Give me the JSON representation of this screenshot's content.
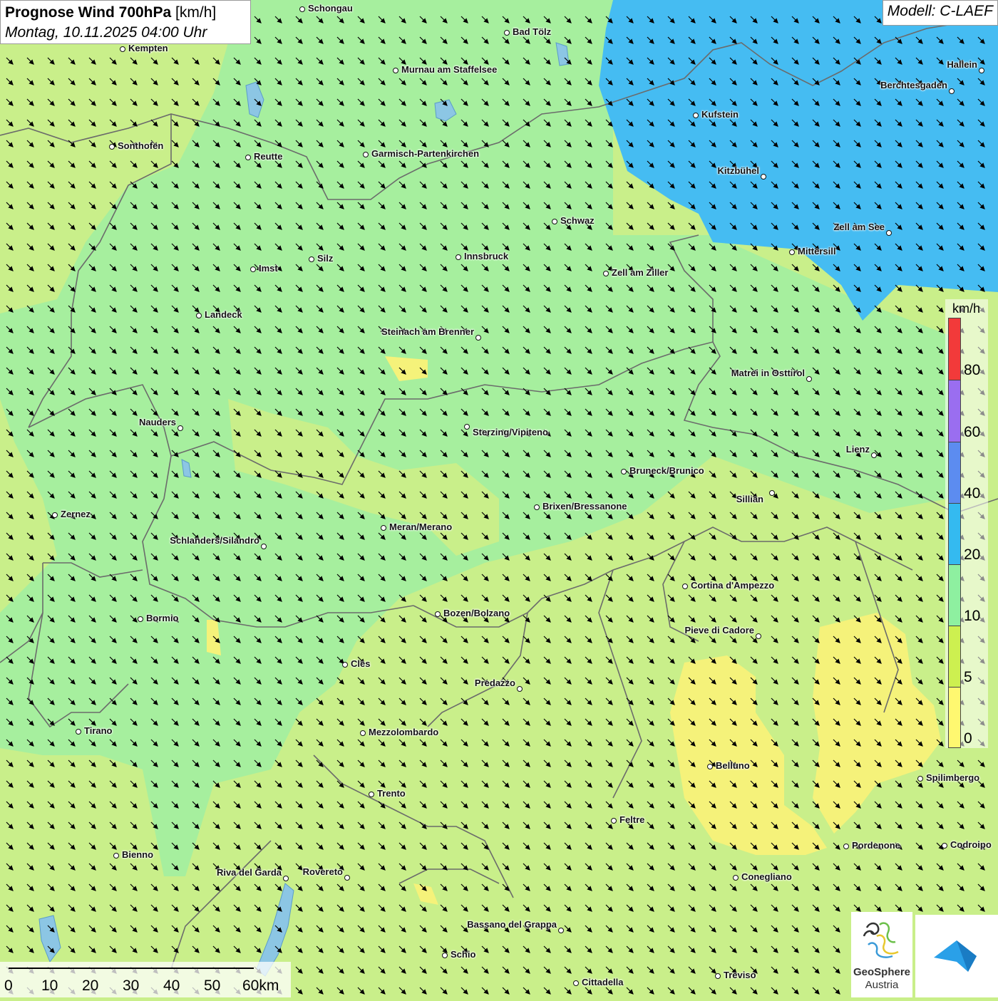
{
  "title": {
    "main": "Prognose Wind 700hPa",
    "unit": "[km/h]",
    "datetime": "Montag, 10.11.2025 04:00 Uhr"
  },
  "model": "Modell: C-LAEF",
  "legend": {
    "unit": "km/h",
    "labels": [
      "80",
      "60",
      "40",
      "20",
      "10",
      "5",
      "0"
    ],
    "colors": {
      "80_plus": "#f23a3a",
      "60_80": "#9a6ef0",
      "40_60": "#5c8cf0",
      "20_40": "#34baf0",
      "10_20": "#8ef0a0",
      "5_10": "#cdf050",
      "0_5": "#fff870"
    }
  },
  "map_colors": {
    "calm_yellow": "#f5f27a",
    "light_yellowgreen": "#c9ef8a",
    "green": "#a6ef9e",
    "blue": "#41b8f0",
    "border": "#6b6b6b",
    "lake": "#7ab6d8"
  },
  "cities": [
    {
      "name": "Schongau"
    },
    {
      "name": "Bad Tölz"
    },
    {
      "name": "Kempten"
    },
    {
      "name": "Murnau am Staffelsee"
    },
    {
      "name": "Hallein"
    },
    {
      "name": "Berchtesgaden"
    },
    {
      "name": "Kufstein"
    },
    {
      "name": "Sonthofen"
    },
    {
      "name": "Reutte"
    },
    {
      "name": "Garmisch-Partenkirchen"
    },
    {
      "name": "Kitzbühel"
    },
    {
      "name": "Schwaz"
    },
    {
      "name": "Zell am See"
    },
    {
      "name": "Mittersill"
    },
    {
      "name": "Innsbruck"
    },
    {
      "name": "Silz"
    },
    {
      "name": "Imst"
    },
    {
      "name": "Zell am Ziller"
    },
    {
      "name": "Landeck"
    },
    {
      "name": "Steinach am Brenner"
    },
    {
      "name": "Matrei in Osttirol"
    },
    {
      "name": "Nauders"
    },
    {
      "name": "Sterzing/Vipiteno"
    },
    {
      "name": "Lienz"
    },
    {
      "name": "Bruneck/Brunico"
    },
    {
      "name": "Sillian"
    },
    {
      "name": "Brixen/Bressanone"
    },
    {
      "name": "Zernez"
    },
    {
      "name": "Meran/Merano"
    },
    {
      "name": "Schlanders/Silandro"
    },
    {
      "name": "Cortina d'Ampezzo"
    },
    {
      "name": "Bozen/Bolzano"
    },
    {
      "name": "Bormio"
    },
    {
      "name": "Pieve di Cadore"
    },
    {
      "name": "Cles"
    },
    {
      "name": "Predazzo"
    },
    {
      "name": "Tirano"
    },
    {
      "name": "Mezzolombardo"
    },
    {
      "name": "Belluno"
    },
    {
      "name": "Spilimbergo"
    },
    {
      "name": "Trento"
    },
    {
      "name": "Feltre"
    },
    {
      "name": "Pordenone"
    },
    {
      "name": "Codroipo"
    },
    {
      "name": "Bienno"
    },
    {
      "name": "Riva del Garda"
    },
    {
      "name": "Rovereto"
    },
    {
      "name": "Conegliano"
    },
    {
      "name": "Bassano del Grappa"
    },
    {
      "name": "Schio"
    },
    {
      "name": "Treviso"
    },
    {
      "name": "Cittadella"
    }
  ],
  "scale": {
    "ticks": [
      "0",
      "10",
      "20",
      "30",
      "40",
      "50",
      "60km"
    ]
  },
  "logo": {
    "line1": "GeoSphere",
    "line2": "Austria"
  }
}
